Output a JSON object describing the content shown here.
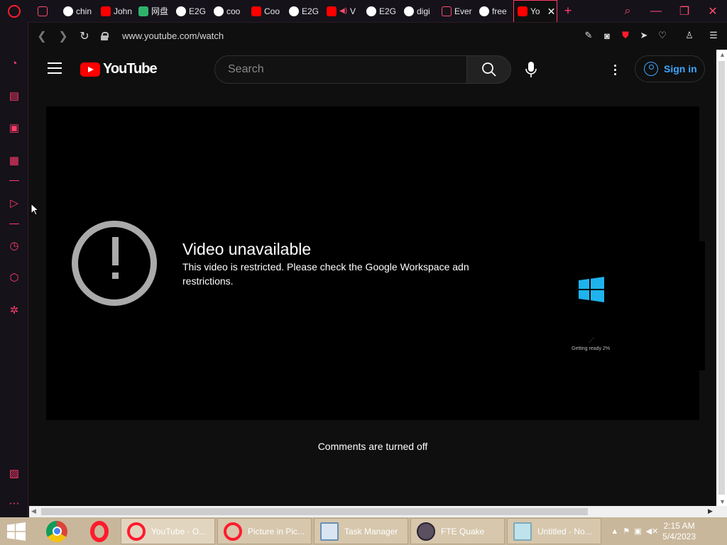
{
  "browser": {
    "tabs": [
      {
        "label": "chin",
        "favicon": "globe-icon"
      },
      {
        "label": "John",
        "favicon": "youtube-icon"
      },
      {
        "label": "网盘",
        "favicon": "share-icon"
      },
      {
        "label": "E2G",
        "favicon": "github-icon"
      },
      {
        "label": "coo",
        "favicon": "globe-icon"
      },
      {
        "label": "Coo",
        "favicon": "youtube-icon"
      },
      {
        "label": "E2G",
        "favicon": "globe-icon"
      },
      {
        "label": "V",
        "favicon": "youtube-icon"
      },
      {
        "label": "E2G",
        "favicon": "globe-icon"
      },
      {
        "label": "digi",
        "favicon": "globe-icon"
      },
      {
        "label": "Ever",
        "favicon": "tv-icon"
      },
      {
        "label": "free",
        "favicon": "globe-icon"
      },
      {
        "label": "Yo",
        "favicon": "youtube-icon",
        "active": true
      }
    ],
    "new_tab": "+",
    "url": "www.youtube.com/watch",
    "accent_color": "#ff1b2d"
  },
  "youtube": {
    "logo_text": "YouTube",
    "search_placeholder": "Search",
    "sign_in": "Sign in",
    "error_title": "Video unavailable",
    "error_message": "This video is restricted. Please check the Google Workspace adn restrictions.",
    "getting_ready": "Getting ready 2%",
    "comments_off": "Comments are turned off",
    "link_color": "#3ea6ff"
  },
  "taskbar": {
    "tasks": [
      {
        "label": "YouTube - O...",
        "icon": "opera-icon"
      },
      {
        "label": "Picture in Pic...",
        "icon": "opera-icon"
      },
      {
        "label": "Task Manager",
        "icon": "task-manager-icon"
      },
      {
        "label": "FTE Quake",
        "icon": "quake-icon"
      },
      {
        "label": "Untitled - No...",
        "icon": "notepad-icon"
      }
    ],
    "time": "2:15 AM",
    "date": "5/4/2023"
  }
}
